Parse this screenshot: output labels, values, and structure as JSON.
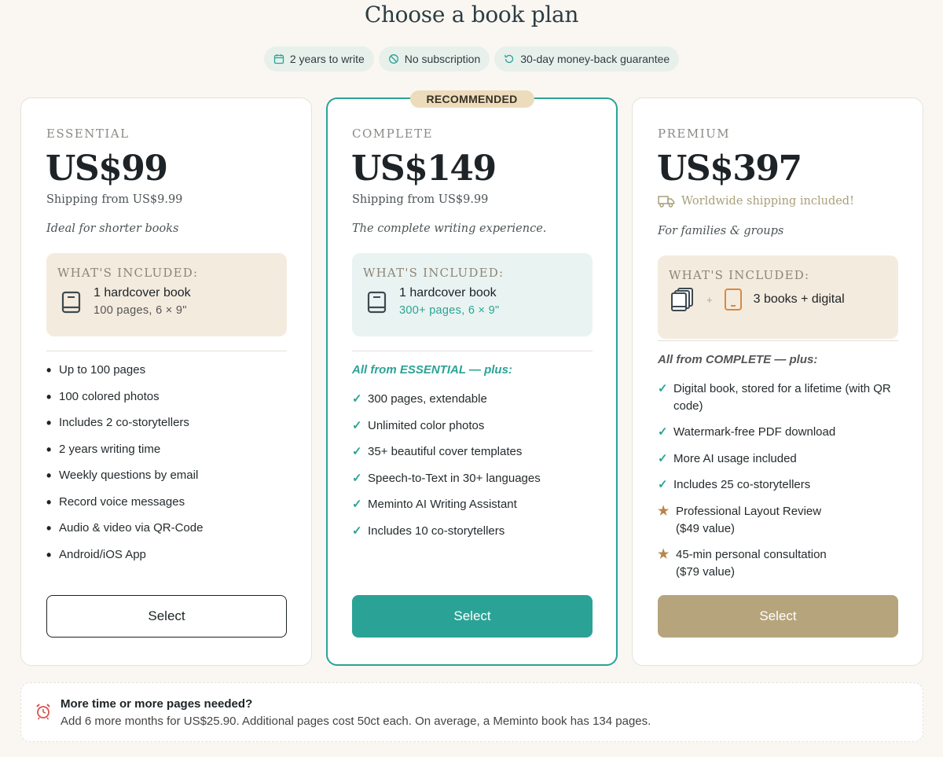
{
  "page": {
    "title": "Choose a book plan"
  },
  "badges": [
    {
      "icon": "calendar-icon",
      "label": "2 years to write"
    },
    {
      "icon": "no-subscription-icon",
      "label": "No subscription"
    },
    {
      "icon": "refresh-icon",
      "label": "30-day money-back guarantee"
    }
  ],
  "colors": {
    "teal": "#2aa396",
    "gold": "#b6a47c",
    "beige": "#f4ebdf",
    "mint": "#e9f4f2",
    "star": "#b8864b"
  },
  "plans": {
    "essential": {
      "tier": "ESSENTIAL",
      "price": "US$99",
      "shipping": "Shipping from US$9.99",
      "tagline": "Ideal for shorter books",
      "included_head": "WHAT'S INCLUDED:",
      "included_main": "1 hardcover book",
      "included_sub": "100 pages, 6 × 9\"",
      "features": [
        "Up to 100 pages",
        "100 colored photos",
        "Includes 2 co-storytellers",
        "2 years writing time",
        "Weekly questions by email",
        "Record voice messages",
        "Audio & video via QR-Code",
        "Android/iOS App"
      ],
      "select_label": "Select"
    },
    "complete": {
      "recommended": "RECOMMENDED",
      "tier": "COMPLETE",
      "price": "US$149",
      "shipping": "Shipping from US$9.99",
      "tagline": "The complete writing experience.",
      "included_head": "WHAT'S INCLUDED:",
      "included_main": "1 hardcover book",
      "included_sub": "300+ pages, 6 × 9\"",
      "plus_head": "All from ESSENTIAL — plus:",
      "features": [
        "300 pages, extendable",
        "Unlimited color photos",
        "35+ beautiful cover templates",
        "Speech-to-Text in 30+ languages",
        "Meminto AI Writing Assistant",
        "Includes 10 co-storytellers"
      ],
      "select_label": "Select"
    },
    "premium": {
      "tier": "PREMIUM",
      "price": "US$397",
      "shipping": "Worldwide shipping included!",
      "tagline": "For families & groups",
      "included_head": "WHAT'S INCLUDED:",
      "included_plus": "+",
      "included_main": "3 books + digital",
      "plus_head": "All from COMPLETE — plus:",
      "features": [
        {
          "mark": "check",
          "text": "Digital book, stored for a lifetime (with QR code)"
        },
        {
          "mark": "check",
          "text": "Watermark-free PDF download"
        },
        {
          "mark": "check",
          "text": "More AI usage included"
        },
        {
          "mark": "check",
          "text": "Includes 25 co-storytellers"
        },
        {
          "mark": "star",
          "text": "Professional Layout Review ($49 value)"
        },
        {
          "mark": "star",
          "text": "45-min personal consultation ($79 value)"
        }
      ],
      "select_label": "Select"
    }
  },
  "info": {
    "title": "More time or more pages needed?",
    "body": "Add 6 more months for US$25.90. Additional pages cost 50ct each. On average, a Meminto book has 134 pages."
  }
}
